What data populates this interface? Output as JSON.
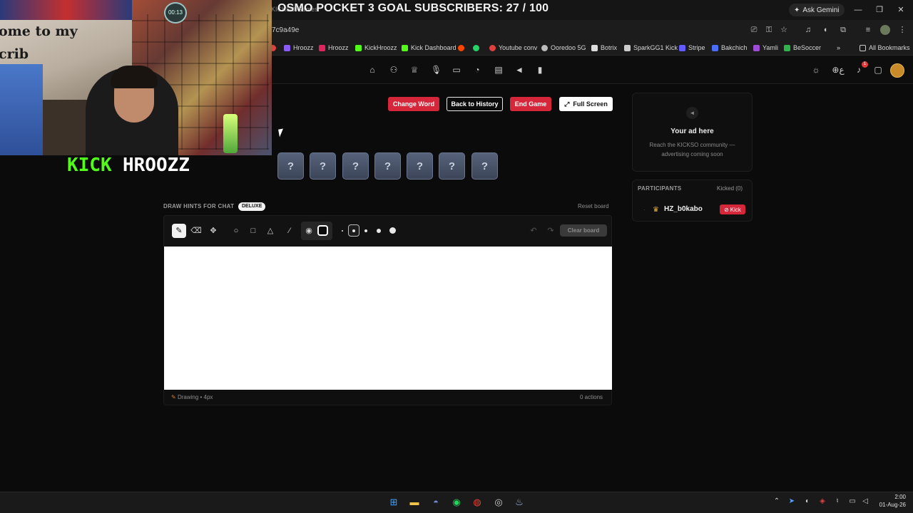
{
  "browser": {
    "stream_overlay_title": "OSMO POCKET 3 GOAL SUBSCRIBERS: 27 / 100",
    "tab_ghost": "KICKSO Games",
    "ask_gemini": "Ask Gemini",
    "url_fragment": "7c9a49e",
    "bookmarks": [
      {
        "label": "Hroozz",
        "color": "#8a5cf6"
      },
      {
        "label": "Hroozz",
        "color": "#e0245e"
      },
      {
        "label": "KickHroozz",
        "color": "#53fc18"
      },
      {
        "label": "Kick Dashboard",
        "color": "#53fc18"
      },
      {
        "label": "Youtube conv",
        "color": "#e04040"
      },
      {
        "label": "Ooredoo 5G",
        "color": "#bbbbbb"
      },
      {
        "label": "Botrix",
        "color": "#dddddd"
      },
      {
        "label": "SparkGG1 Kick",
        "color": "#cccccc"
      },
      {
        "label": "Stripe",
        "color": "#635bff"
      },
      {
        "label": "Bakchich",
        "color": "#4a6cf7"
      },
      {
        "label": "Yamli",
        "color": "#a04bd6"
      },
      {
        "label": "BeSoccer",
        "color": "#2fb34a"
      }
    ],
    "all_bookmarks": "All Bookmarks"
  },
  "nav": {
    "icons": [
      "home-icon",
      "users-icon",
      "trophy-icon",
      "microphone-icon",
      "monitor-icon",
      "history-icon",
      "document-icon",
      "megaphone-icon",
      "bottle-icon"
    ],
    "notification_count": "1"
  },
  "actions": {
    "change_word": "Change Word",
    "back_to_history": "Back to History",
    "end_game": "End Game",
    "full_screen": "Full Screen"
  },
  "word_tiles": [
    "?",
    "?",
    "?",
    "?",
    "?",
    "?",
    "?"
  ],
  "draw": {
    "hints_label": "DRAW HINTS FOR CHAT",
    "badge": "DELUXE",
    "reset_board": "Reset board",
    "clear_board": "Clear board",
    "status": "Drawing • 4px",
    "actions_count": "0 actions"
  },
  "ad": {
    "title": "Your ad here",
    "subtitle": "Reach the KICKSO community — advertising coming soon"
  },
  "participants": {
    "title": "PARTICIPANTS",
    "kicked": "Kicked (0)",
    "list": [
      {
        "name": "HZ_b0kabo",
        "action": "Kick"
      }
    ]
  },
  "webcam": {
    "caption": "ome to my crib",
    "clock": "00:13",
    "brand": "KICK",
    "channel": "HROOZZ"
  },
  "taskbar": {
    "time": "2:00",
    "date": "01-Aug-26"
  }
}
